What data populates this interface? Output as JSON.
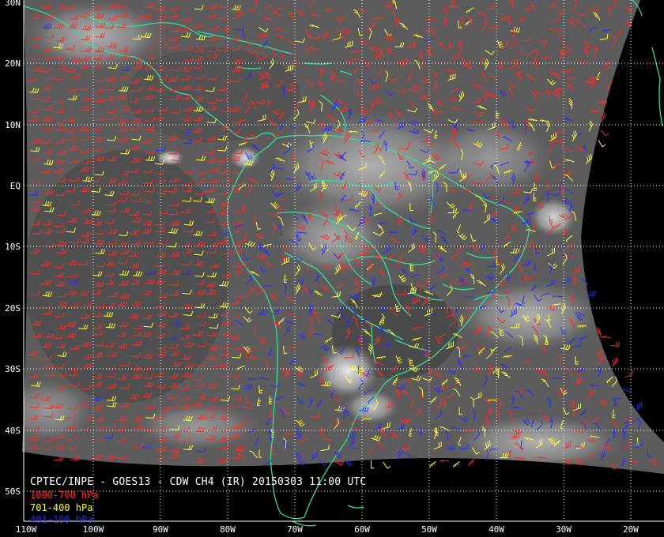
{
  "map": {
    "caption": "CPTEC/INPE - GOES13 - CDW CH4 (IR) 20150303 11:00 UTC",
    "lat_labels": [
      "30N",
      "20N",
      "10N",
      "EQ",
      "10S",
      "20S",
      "30S",
      "40S",
      "50S"
    ],
    "lon_labels": [
      "110W",
      "100W",
      "90W",
      "80W",
      "70W",
      "60W",
      "50W",
      "40W",
      "30W",
      "20W"
    ],
    "legend": [
      {
        "label": "1000-700 hPa",
        "color": "#ff2a2a"
      },
      {
        "label": "701-400 hPa",
        "color": "#ffff33"
      },
      {
        "label": "401-100 hPa",
        "color": "#2a2aff"
      }
    ],
    "colors": {
      "background": "#000000",
      "coastline": "#33dd99",
      "grid": "#ffffff",
      "imagery": "#5a5a5a"
    }
  }
}
